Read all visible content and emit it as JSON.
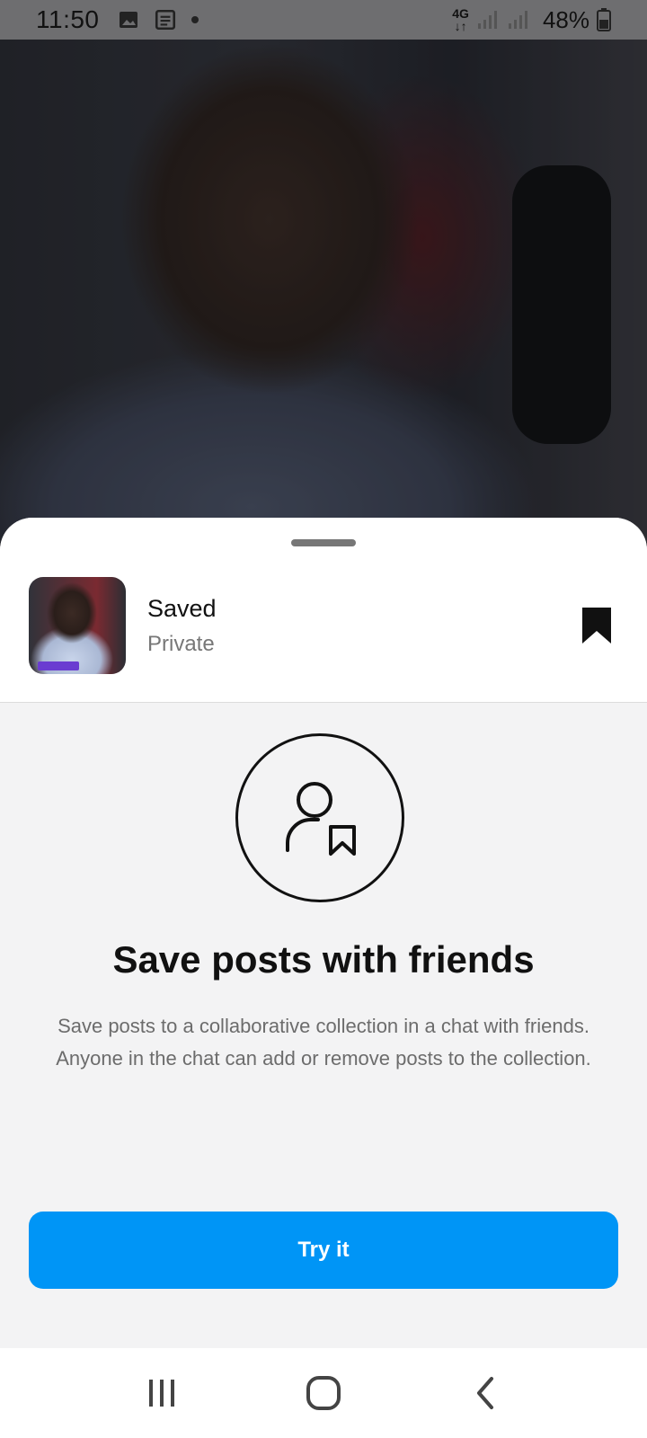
{
  "status_bar": {
    "time": "11:50",
    "network": "4G",
    "battery": "48%",
    "icons": [
      "image-icon",
      "news-icon",
      "notification-dot",
      "signal-icon",
      "signal-icon",
      "battery-icon"
    ]
  },
  "collection": {
    "name": "Saved",
    "privacy": "Private",
    "bookmark_icon": "bookmark-filled-icon"
  },
  "promo": {
    "icon": "person-bookmark-icon",
    "title": "Save posts with friends",
    "description": "Save posts to a collaborative collection in a chat with friends. Anyone in the chat can add or remove posts to the collection.",
    "button_label": "Try it",
    "button_color": "#0095f6"
  },
  "nav_bar": {
    "items": [
      "recents-icon",
      "home-icon",
      "back-icon"
    ]
  }
}
